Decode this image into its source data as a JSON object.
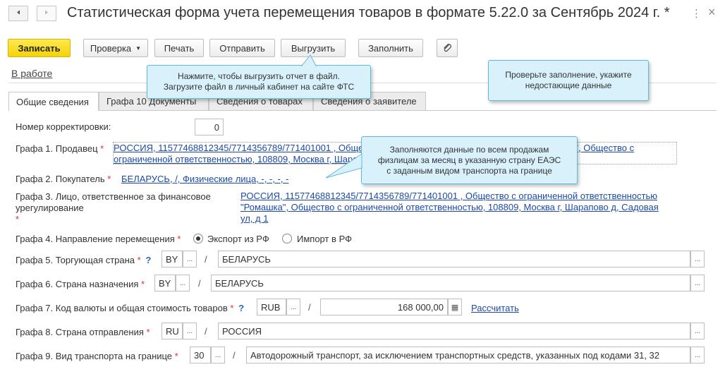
{
  "window": {
    "back_icon": "arrow-left-icon",
    "forward_icon": "arrow-right-icon",
    "title": "Статистическая форма учета перемещения товаров в формате 5.22.0 за Сентябрь 2024 г. *",
    "more_icon": "⋮",
    "close_icon": "×"
  },
  "toolbar": {
    "save_label": "Записать",
    "check_label": "Проверка",
    "print_label": "Печать",
    "send_label": "Отправить",
    "export_label": "Выгрузить",
    "fill_label": "Заполнить",
    "attach_icon": "paperclip-icon"
  },
  "status": {
    "label": "В работе"
  },
  "tabs": [
    {
      "label": "Общие сведения"
    },
    {
      "label": "Графа 10 Документы"
    },
    {
      "label": "Сведения о товарах"
    },
    {
      "label": "Сведения о заявителе"
    }
  ],
  "callouts": {
    "export": [
      "Нажмите, чтобы выгрузить отчет в файл.",
      "Загрузите файл в личный кабинет на сайте ФТС"
    ],
    "check": [
      "Проверьте заполнение, укажите",
      "недостающие данные"
    ],
    "buyer": [
      "Заполняются данные по всем продажам",
      "физлицам за месяц в указанную страну ЕАЭС",
      "с заданным видом транспорта на границе"
    ]
  },
  "form": {
    "correction": {
      "label": "Номер корректировки:",
      "value": "0"
    },
    "seller": {
      "label": "Графа 1. Продавец",
      "lines": [
        "РОССИЯ, 11577468812345/7714356789/771401001 , Общество с ограниченной ответственностью \"Ромашка\", Общество с",
        "ограниченной ответственностью, 108809, Москва г, Шарапово д, Садовая ул, д 1"
      ]
    },
    "buyer": {
      "label": "Графа 2. Покупатель",
      "value": "БЕЛАРУСЬ, /, Физические лица, -, -, -, -"
    },
    "responsible": {
      "label_lines": [
        "Графа 3. Лицо, ответственное за финансовое",
        "урегулирование"
      ],
      "lines": [
        "РОССИЯ, 11577468812345/7714356789/771401001 , Общество с ограниченной ответственностью",
        "\"Ромашка\", Общество с ограниченной ответственностью, 108809, Москва г, Шарапово д, Садовая",
        "ул, д 1"
      ]
    },
    "direction": {
      "label": "Графа 4. Направление перемещения",
      "option_export": "Экспорт из РФ",
      "option_import": "Импорт в РФ",
      "selected": "Экспорт из РФ"
    },
    "trading_country": {
      "label": "Графа 5. Торгующая страна",
      "help": "?",
      "code": "BY",
      "name": "БЕЛАРУСЬ"
    },
    "destination_country": {
      "label": "Графа 6. Страна назначения",
      "code": "BY",
      "name": "БЕЛАРУСЬ"
    },
    "currency": {
      "label": "Графа 7. Код валюты и общая стоимость товаров",
      "help": "?",
      "code": "RUB",
      "amount": "168 000,00",
      "calc_link": "Рассчитать"
    },
    "origin_country": {
      "label": "Графа 8. Страна отправления",
      "code": "RU",
      "name": "РОССИЯ"
    },
    "transport": {
      "label": "Графа 9. Вид транспорта на границе",
      "code": "30",
      "name": "Автодорожный транспорт, за исключением транспортных средств, указанных под кодами 31, 32"
    },
    "dots": "...",
    "slash": "/",
    "required_mark": "*"
  },
  "colors": {
    "primary_button": "#f5d308",
    "callout_bg": "#d9f1fb",
    "callout_border": "#5fb9de",
    "link": "#1c4aa8",
    "required": "#e03030"
  }
}
